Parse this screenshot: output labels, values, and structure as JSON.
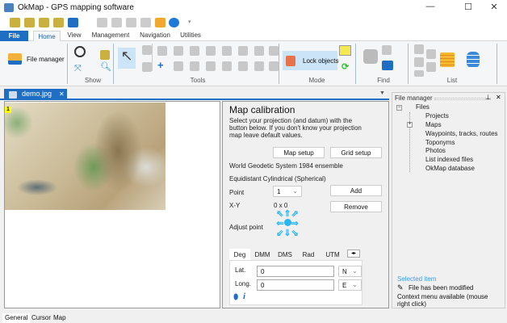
{
  "window": {
    "title": "OkMap - GPS mapping software",
    "minimize": "—",
    "maximize": "☐",
    "close": "✕"
  },
  "ribbon": {
    "tabs": [
      {
        "label": "File"
      },
      {
        "label": "Home"
      },
      {
        "label": "View"
      },
      {
        "label": "Management"
      },
      {
        "label": "Navigation"
      },
      {
        "label": "Utilities"
      }
    ],
    "groups": {
      "file_manager": "File manager",
      "show": "Show",
      "tools": "Tools",
      "mode": "Mode",
      "lock_objects": "Lock objects",
      "find": "Find",
      "list": "List"
    }
  },
  "document_tab": {
    "label": "demo.jpg",
    "close": "✕"
  },
  "map": {
    "point_marker": "1"
  },
  "calibration": {
    "title": "Map calibration",
    "description": "Select your projection (and datum) with the button below. If you don't know your projection map leave default values.",
    "map_setup": "Map setup",
    "grid_setup": "Grid setup",
    "datum": "World Geodetic System 1984 ensemble",
    "projection": "Equidistant Cylindrical (Spherical)",
    "point_label": "Point",
    "point_value": "1",
    "add": "Add",
    "remove": "Remove",
    "xy_label": "X-Y",
    "xy_value": "0 x 0",
    "adjust_label": "Adjust point",
    "coord_tabs": [
      "Deg",
      "DMM",
      "DMS",
      "Rad",
      "UTM"
    ],
    "lat_label": "Lat.",
    "lat_value": "0",
    "lat_hemi": "N",
    "long_label": "Long.",
    "long_value": "0",
    "long_hemi": "E"
  },
  "file_manager": {
    "title": "File manager",
    "root": "Files",
    "items": [
      "Projects",
      "Maps",
      "Waypoints, tracks, routes",
      "Toponyms",
      "Photos",
      "List indexed files",
      "OkMap database"
    ],
    "selected_label": "Selected item",
    "modified": "File has been modified",
    "context": "Context menu available (mouse right click)"
  },
  "bottom_tabs": [
    "General",
    "Cursor",
    "Map"
  ],
  "colors": {
    "accent": "#1e6fc4",
    "arrows": "#29b6f6",
    "selected": "#3c9cf0"
  }
}
